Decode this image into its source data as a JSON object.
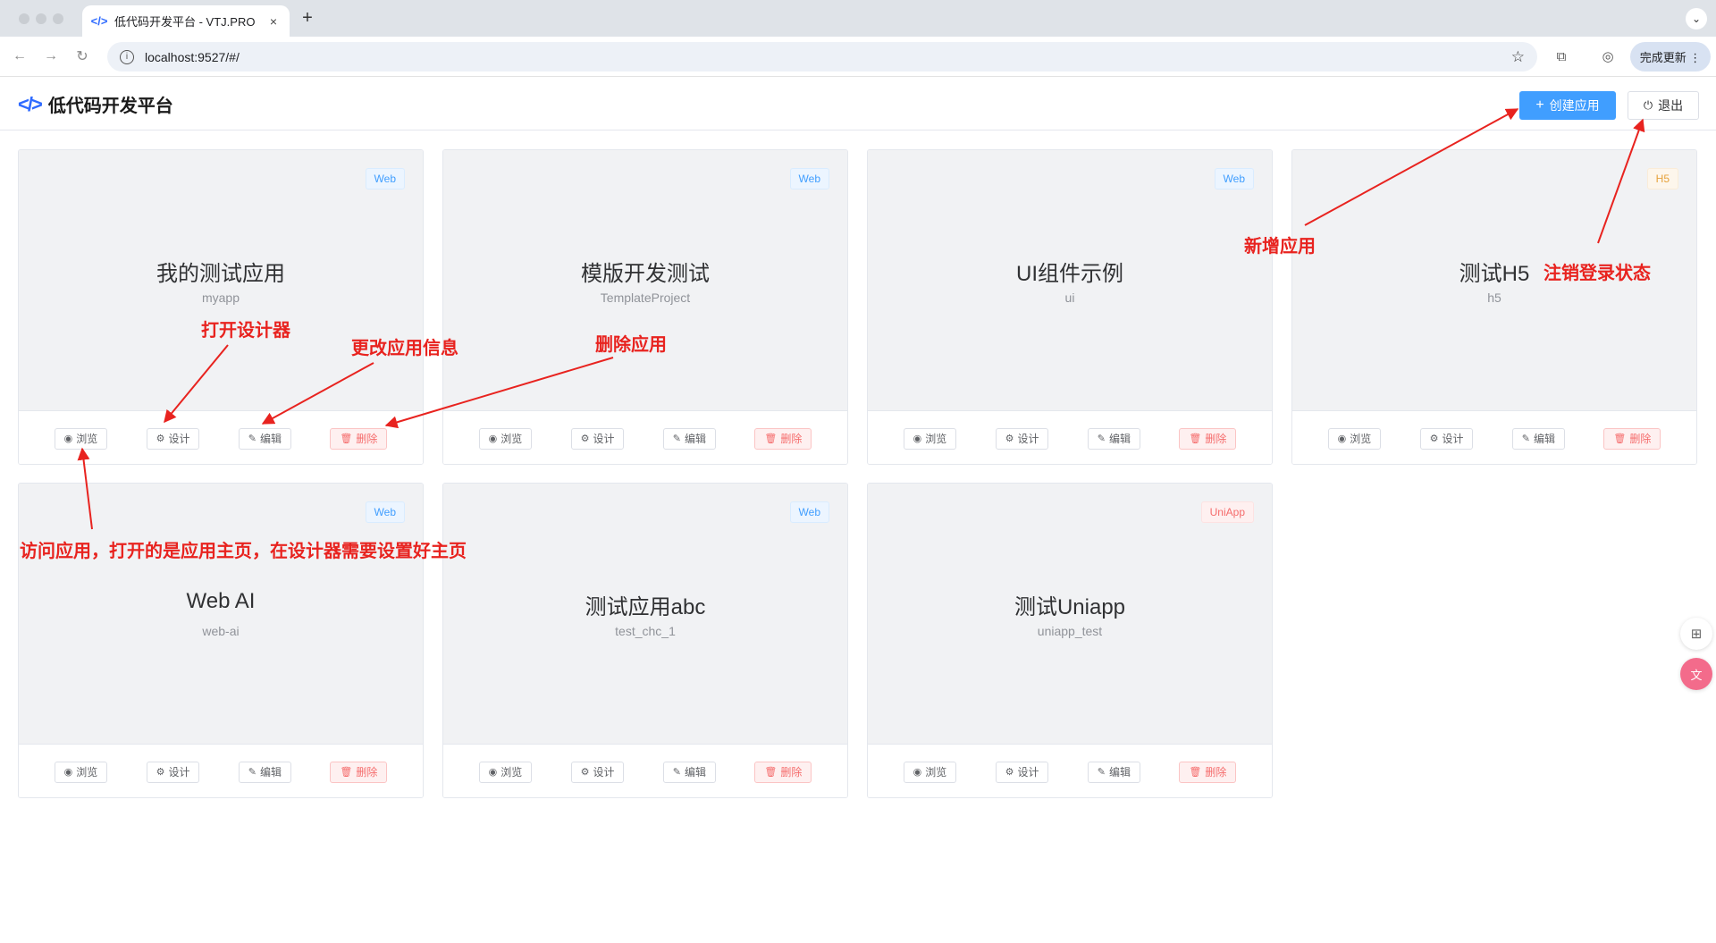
{
  "browser": {
    "tab_title": "低代码开发平台 - VTJ.PRO",
    "tab_favicon": "</>",
    "close_glyph": "×",
    "newtab_glyph": "+",
    "menu_glyph": "⌄",
    "back_glyph": "←",
    "forward_glyph": "→",
    "reload_glyph": "↻",
    "info_glyph": "i",
    "url": "localhost:9527/#/",
    "star_glyph": "☆",
    "extension_glyph": "⧉",
    "profile_glyph": "◎",
    "update_label": "完成更新 ⋮"
  },
  "header": {
    "logo_icon": "</>",
    "title": "低代码开发平台",
    "create_plus": "+",
    "create_label": "创建应用",
    "logout_glyph": "⏻",
    "logout_label": "退出"
  },
  "action_labels": {
    "view": "浏览",
    "design": "设计",
    "edit": "编辑",
    "delete": "删除",
    "view_icon": "◉",
    "design_icon": "⚙",
    "edit_icon": "✎",
    "delete_icon": "🗑"
  },
  "apps": [
    {
      "name": "我的测试应用",
      "code": "myapp",
      "platform": "Web"
    },
    {
      "name": "模版开发测试",
      "code": "TemplateProject",
      "platform": "Web"
    },
    {
      "name": "UI组件示例",
      "code": "ui",
      "platform": "Web"
    },
    {
      "name": "测试H5",
      "code": "h5",
      "platform": "H5"
    },
    {
      "name": "Web AI",
      "code": "web-ai",
      "platform": "Web"
    },
    {
      "name": "测试应用abc",
      "code": "test_chc_1",
      "platform": "Web"
    },
    {
      "name": "测试Uniapp",
      "code": "uniapp_test",
      "platform": "UniApp"
    }
  ],
  "annotations": {
    "open_designer": "打开设计器",
    "change_info": "更改应用信息",
    "delete_app": "删除应用",
    "add_app": "新增应用",
    "logout_state": "注销登录状态",
    "visit_app": "访问应用，打开的是应用主页，在设计器需要设置好主页"
  },
  "colors": {
    "primary": "#409eff",
    "danger": "#f56c6c",
    "warning": "#e6a23c",
    "annotation": "#e8231f"
  },
  "side_widgets": {
    "grid_glyph": "⊞",
    "translate_glyph": "文"
  }
}
